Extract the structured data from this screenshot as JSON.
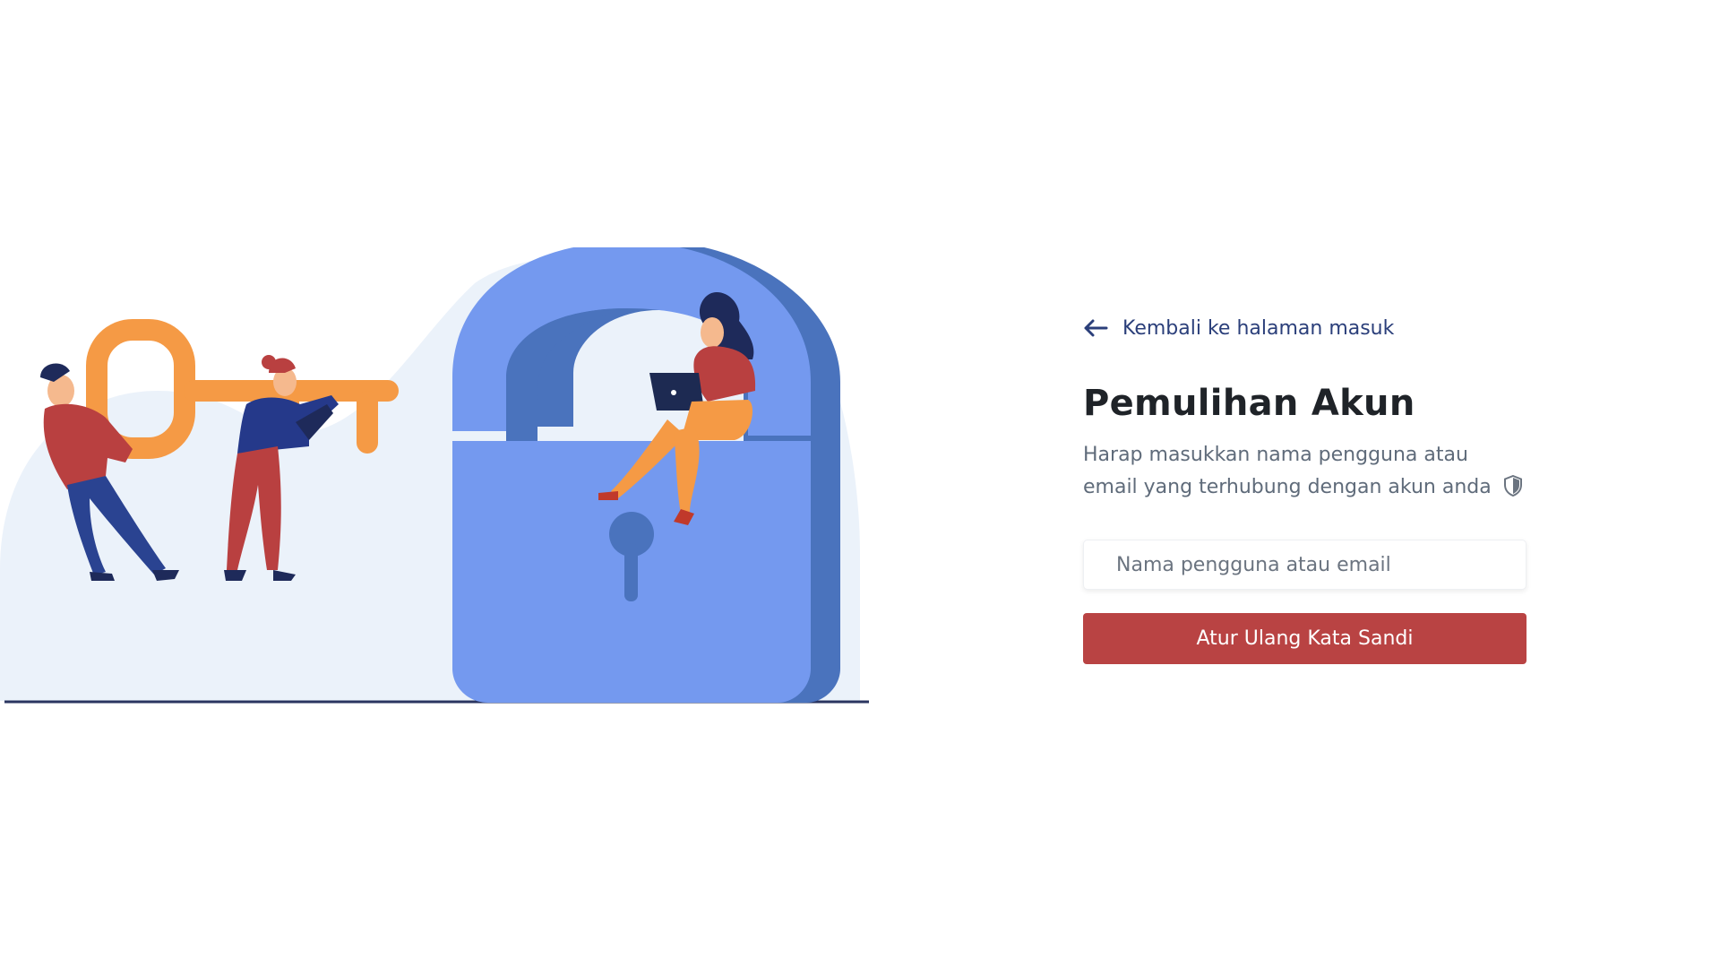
{
  "colors": {
    "accent_button": "#b94343",
    "link": "#2b3f7a",
    "title": "#1f2328",
    "description": "#5f6b7a"
  },
  "illustration": {
    "icon": "padlock-key-people-illustration"
  },
  "back_link": {
    "icon": "arrow-left-icon",
    "label": "Kembali ke halaman masuk"
  },
  "header": {
    "title": "Pemulihan Akun"
  },
  "description": {
    "text": "Harap masukkan nama pengguna atau email yang terhubung dengan akun anda",
    "icon": "shield-icon"
  },
  "form": {
    "username_field": {
      "value": "",
      "placeholder": "Nama pengguna atau email"
    },
    "submit_label": "Atur Ulang Kata Sandi"
  }
}
